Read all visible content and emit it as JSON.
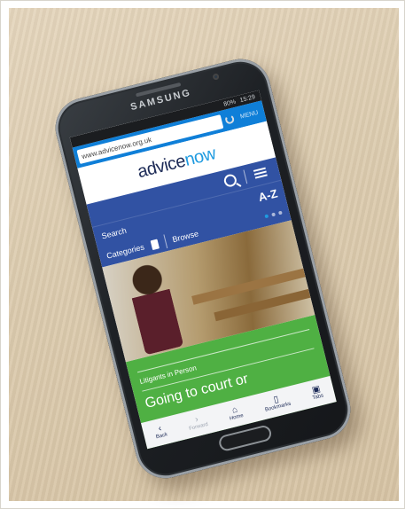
{
  "phone": {
    "brand": "SAMSUNG",
    "status": {
      "battery": "80%",
      "time": "15:29"
    }
  },
  "browser": {
    "url": "www.advicenow.org.uk",
    "menu_label": "MENU"
  },
  "site": {
    "logo_prefix": "advice",
    "logo_suffix": "now",
    "search_label": "Search",
    "az_label": "A-Z",
    "categories_label": "Categories",
    "browse_label": "Browse"
  },
  "article": {
    "tag": "Litigants in Person",
    "headline": "Going to court or"
  },
  "bottom_nav": [
    {
      "label": "Back",
      "icon": "back-arrow",
      "enabled": true
    },
    {
      "label": "Forward",
      "icon": "forward-arrow",
      "enabled": false
    },
    {
      "label": "Home",
      "icon": "home",
      "enabled": true
    },
    {
      "label": "Bookmarks",
      "icon": "bookmark",
      "enabled": true
    },
    {
      "label": "Tabs",
      "icon": "tabs",
      "enabled": true
    }
  ],
  "colors": {
    "site_blue": "#3152a3",
    "accent_blue": "#1f9be0",
    "green": "#4fb043",
    "browser_blue": "#0f7fd8"
  }
}
